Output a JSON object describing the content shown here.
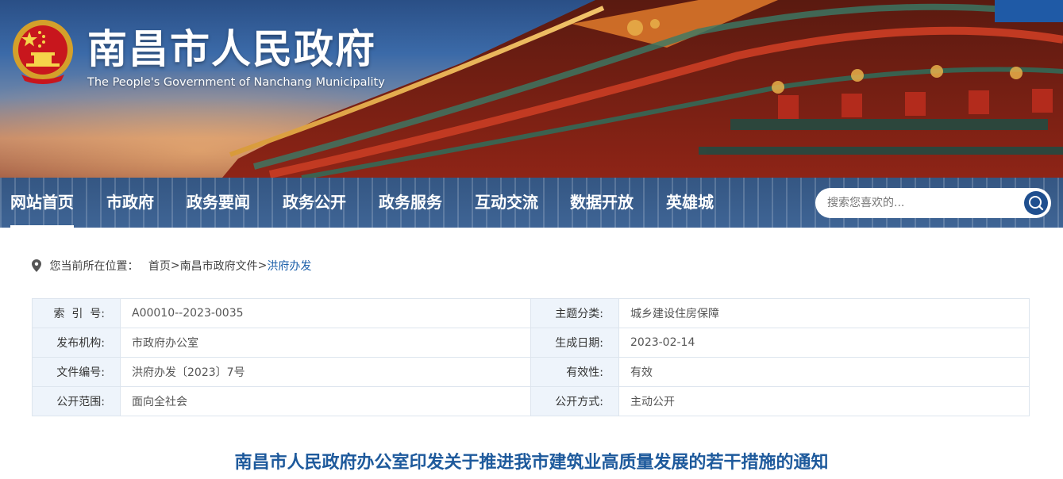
{
  "header": {
    "site_title": "南昌市人民政府",
    "site_subtitle": "The People's Government of Nanchang Municipality",
    "emblem_icon": "national-emblem-icon"
  },
  "nav": {
    "items": [
      {
        "label": "网站首页",
        "active": true
      },
      {
        "label": "市政府"
      },
      {
        "label": "政务要闻"
      },
      {
        "label": "政务公开"
      },
      {
        "label": "政务服务"
      },
      {
        "label": "互动交流"
      },
      {
        "label": "数据开放"
      },
      {
        "label": "英雄城"
      }
    ],
    "search_placeholder": "搜索您喜欢的...",
    "search_icon": "search-icon"
  },
  "breadcrumb": {
    "prefix": "您当前所在位置：",
    "items": [
      "首页",
      "南昌市政府文件",
      "洪府办发"
    ],
    "separator": ">"
  },
  "info": {
    "rows": [
      {
        "label1": "索  引  号:",
        "value1": "A00010--2023-0035",
        "label2": "主题分类:",
        "value2": "城乡建设住房保障"
      },
      {
        "label1": "发布机构:",
        "value1": "市政府办公室",
        "label2": "生成日期:",
        "value2": "2023-02-14"
      },
      {
        "label1": "文件编号:",
        "value1": "洪府办发〔2023〕7号",
        "label2": "有效性:",
        "value2": "有效"
      },
      {
        "label1": "公开范围:",
        "value1": "面向全社会",
        "label2": "公开方式:",
        "value2": "主动公开"
      }
    ]
  },
  "article": {
    "title": "南昌市人民政府办公室印发关于推进我市建筑业高质量发展的若干措施的通知"
  },
  "colors": {
    "nav_bg": "#2a548a",
    "title_blue": "#1e5a9c",
    "label_bg": "#eef4fb",
    "search_btn": "#1f4f8f"
  }
}
